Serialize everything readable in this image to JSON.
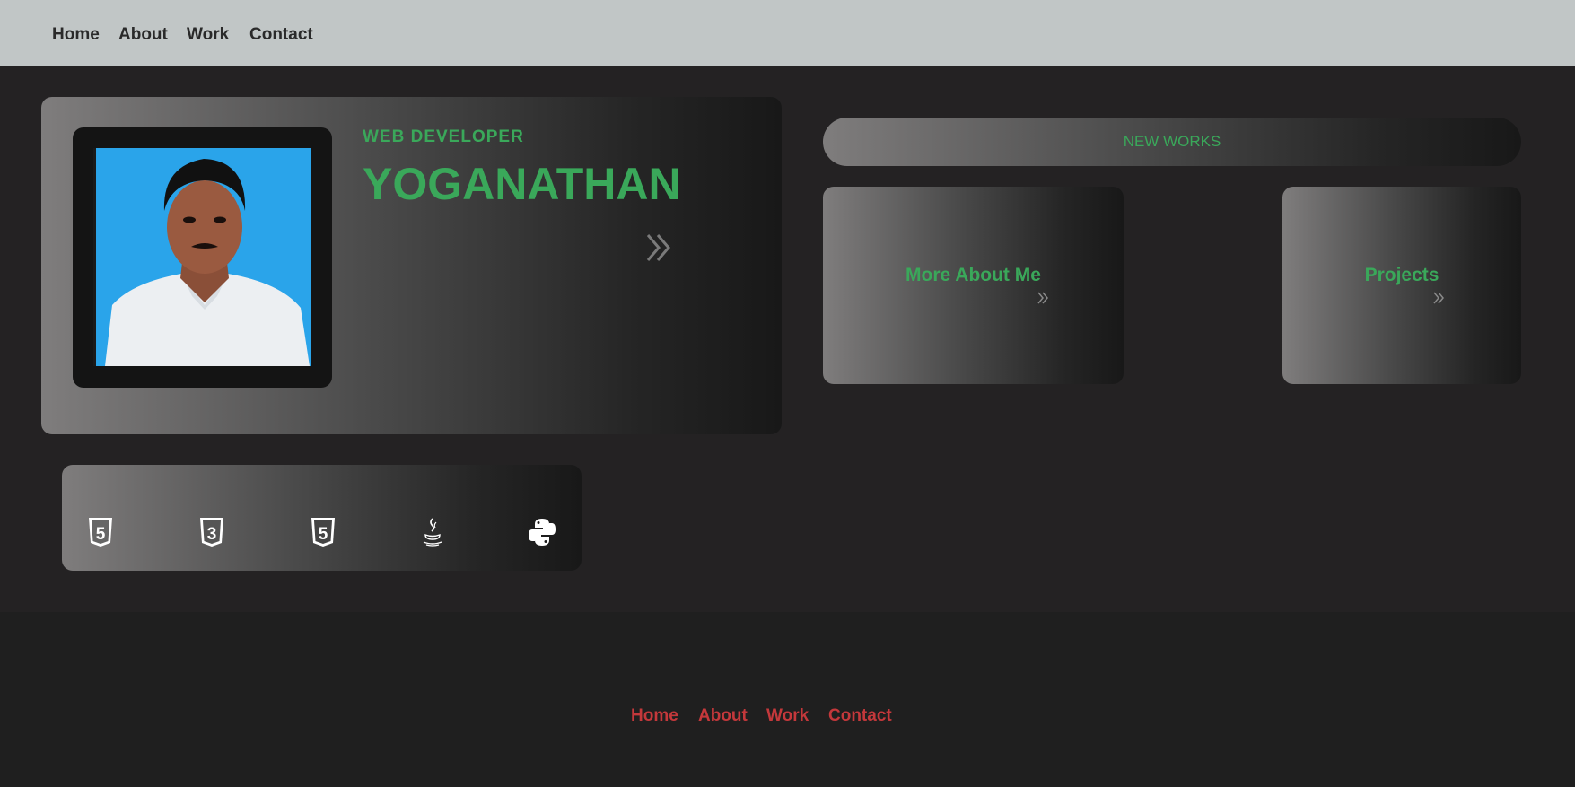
{
  "nav": {
    "items": [
      {
        "label": "Home"
      },
      {
        "label": "About"
      },
      {
        "label": "Work"
      },
      {
        "label": "Contact"
      }
    ]
  },
  "hero": {
    "role": "WEB DEVELOPER",
    "name": "YOGANATHAN",
    "photo_alt": "profile photo"
  },
  "works": {
    "banner": "NEW WORKS",
    "cards": [
      {
        "label": "More About Me"
      },
      {
        "label": "Projects"
      }
    ]
  },
  "skills": {
    "icons": [
      "html5-icon",
      "css3-icon",
      "html5-icon",
      "java-icon",
      "python-icon"
    ]
  },
  "footer": {
    "items": [
      {
        "label": "Home"
      },
      {
        "label": "About"
      },
      {
        "label": "Work"
      },
      {
        "label": "Contact"
      }
    ]
  },
  "colors": {
    "accent_green": "#3aa85a",
    "footer_link_red": "#c4383b",
    "topbar": "#c1c6c6",
    "background": "#242223"
  }
}
